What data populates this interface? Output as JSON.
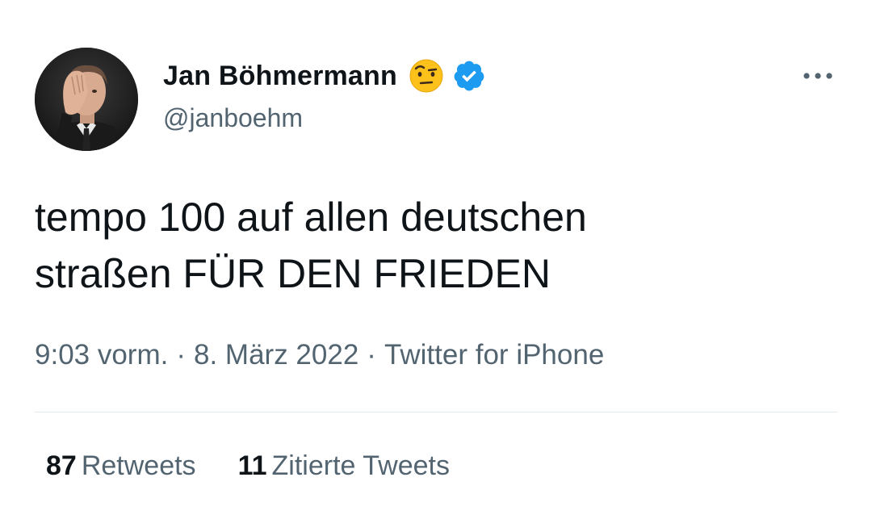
{
  "author": {
    "display_name": "Jan Böhmermann",
    "handle": "@janboehm",
    "emoji_icon": "face-with-raised-eyebrow",
    "verified_icon": "verified-badge-icon",
    "verified_color": "#1d9bf0"
  },
  "tweet": {
    "lines": [
      "tempo 100 auf allen deutschen",
      "straßen FÜR DEN FRIEDEN"
    ]
  },
  "meta": {
    "time": "9:03 vorm.",
    "separator": "·",
    "date": "8. März 2022",
    "source": "Twitter for iPhone"
  },
  "stats": {
    "retweets_count": "87",
    "retweets_label": "Retweets",
    "quotes_count": "11",
    "quotes_label": "Zitierte Tweets"
  },
  "colors": {
    "text_primary": "#0f1419",
    "text_secondary": "#536471",
    "divider": "#e1e8ed"
  }
}
